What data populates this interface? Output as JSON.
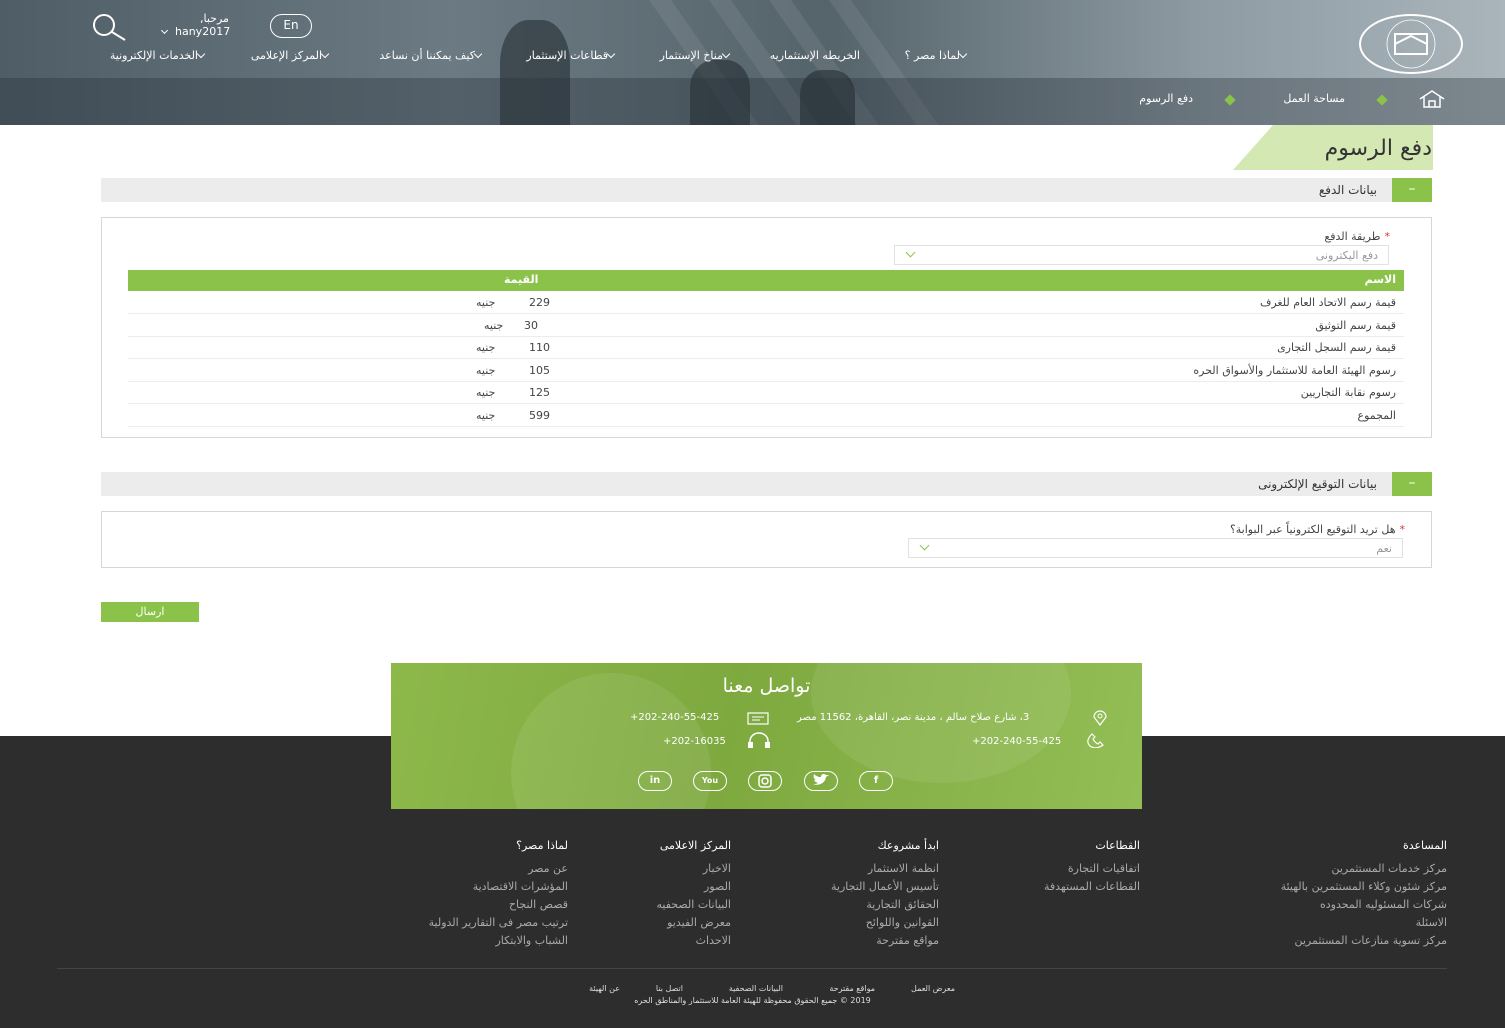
{
  "header": {
    "lang_button": "En",
    "greeting": "مرحبا,",
    "username": "hany2017",
    "nav": [
      "لماذا مصر ؟",
      "الخريطه الإستثماريه",
      "مناخ الإستثمار",
      "قطاعات الإستثمار",
      "كيف يمكننا أن نساعد",
      "المركز الإعلامى",
      "الخدمات الإلكترونية"
    ],
    "breadcrumb": [
      "مساحة العمل",
      "دفع الرسوم"
    ]
  },
  "page": {
    "title": "دفع الرسوم",
    "payment_section": {
      "toggle": "–",
      "title": "بيانات الدفع",
      "method_label": "طريقة الدفع",
      "required_mark": "*",
      "method_value": "دفع اليكترونى",
      "table": {
        "col_name": "الاسم",
        "col_value": "القيمة",
        "currency": "جنيه",
        "rows": [
          {
            "name": "قيمة رسم الاتحاد العام للغرف",
            "value": "229"
          },
          {
            "name": "قيمة رسم التوثيق",
            "value": "30"
          },
          {
            "name": "قيمة رسم السجل التجارى",
            "value": "110"
          },
          {
            "name": "رسوم الهيئة العامة للاستثمار والأسواق الحره",
            "value": "105"
          },
          {
            "name": "رسوم نقابة التجاريين",
            "value": "125"
          },
          {
            "name": "المجموع",
            "value": "599"
          }
        ]
      }
    },
    "signature_section": {
      "toggle": "–",
      "title": "بيانات التوقيع الإلكترونى",
      "question": "هل تريد التوقيع الكترونياً عبر البوابة؟",
      "required_mark": "*",
      "answer": "نعم"
    },
    "submit_label": "ارسال"
  },
  "contact": {
    "title": "تواصل معنا",
    "address": "3، شارع صلاح سالم ، مدينة نصر، القاهرة، 11562 مصر",
    "fax": "+202-240-55-425",
    "phone": "+202-240-55-425",
    "hotline": "+202-16035",
    "social": [
      "f-icon",
      "twitter-icon",
      "instagram-icon",
      "youtube-icon",
      "linkedin-icon"
    ]
  },
  "footer": {
    "columns": [
      {
        "title": "المساعدة",
        "links": [
          "مركز خدمات المستثمرين",
          "مركز شئون وكلاء المستثمرين بالهيئة",
          "شركات المسئوليه المحدوده",
          "الاسئلة",
          "مركز تسوية منازعات المستثمرين"
        ]
      },
      {
        "title": "القطاعات",
        "links": [
          "اتفاقيات التجارة",
          "القطاعات المستهدفة"
        ]
      },
      {
        "title": "ابدأ مشروعك",
        "links": [
          "انظمة الاستثمار",
          "تأسيس الأعمال التجارية",
          "الحقائق التجارية",
          "القوانين واللوائح",
          "مواقع مقترحة"
        ]
      },
      {
        "title": "المركز الاعلامى",
        "links": [
          "الاخبار",
          "الصور",
          "البيانات الصحفيه",
          "معرض الفيديو",
          "الاحداث"
        ]
      },
      {
        "title": "لماذا مصر؟",
        "links": [
          "عن مصر",
          "المؤشرات الاقتصادية",
          "قصص النجاح",
          "ترتيب مصر فى التقارير الدولية",
          "الشباب والابتكار"
        ]
      }
    ],
    "bottom_links": [
      "معرض العمل",
      "مواقع مقترحة",
      "البيانات الصحفية",
      "اتصل بنا",
      "عن الهيئة"
    ],
    "copyright": "2019 © جميع الحقوق محفوظة للهيئة العامة للاستثمار والمناطق الحره"
  },
  "colors": {
    "accent": "#8bc34a",
    "footer_bg": "#2d2d2d",
    "section_bg": "#ececec"
  }
}
